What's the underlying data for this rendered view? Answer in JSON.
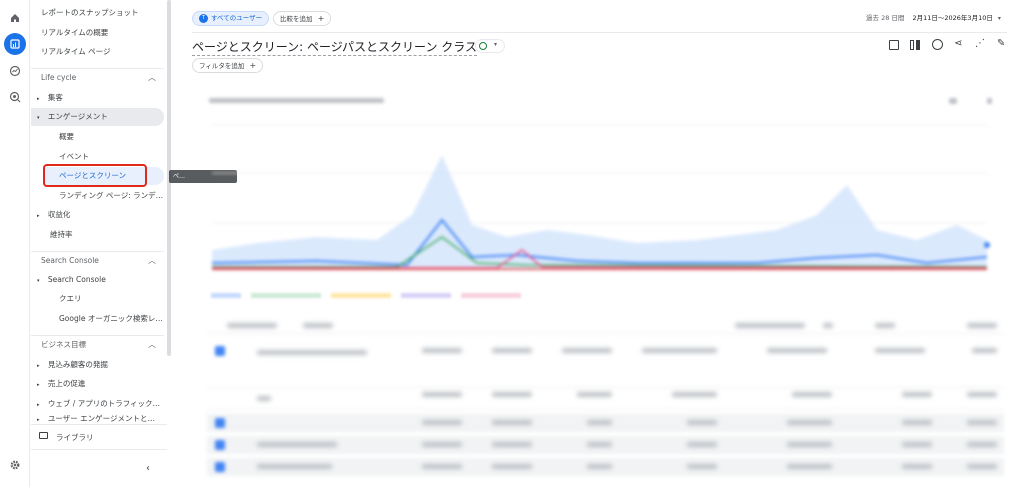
{
  "rail": {
    "icons": [
      "home-icon",
      "reports-icon",
      "explore-icon",
      "advertising-icon",
      "settings-icon"
    ]
  },
  "sidebar": {
    "top_items": [
      "レポートのスナップショット",
      "リアルタイムの概要",
      "リアルタイム ページ"
    ],
    "lifecycle": {
      "heading": "Life cycle",
      "items": [
        {
          "label": "集客"
        },
        {
          "label": "エンゲージメント"
        },
        {
          "label": "概要"
        },
        {
          "label": "イベント"
        },
        {
          "label": "ページとスクリーン"
        },
        {
          "label": "ランディング ページ: ランデ…"
        },
        {
          "label": "収益化"
        },
        {
          "label": "維持率"
        }
      ]
    },
    "search_console": {
      "heading": "Search Console",
      "items": [
        {
          "label": "Search Console"
        },
        {
          "label": "クエリ"
        },
        {
          "label": "Google オーガニック検索レ…"
        }
      ]
    },
    "business": {
      "heading": "ビジネス目標",
      "items": [
        {
          "label": "見込み顧客の発掘"
        },
        {
          "label": "売上の促進"
        },
        {
          "label": "ウェブ / アプリのトラフィック…"
        },
        {
          "label": "ユーザー エンゲージメントと…"
        }
      ]
    },
    "library": "ライブラリ",
    "tooltip": "ペ…"
  },
  "header": {
    "segment_chip": "すべてのユーザー",
    "segment_avatar": "T",
    "compare_chip": "比較を追加",
    "date_prefix": "過去 28 日間",
    "date_range": "2月11日～2026年3月10日",
    "title": "ページとスクリーン: ページパスとスクリーン クラス",
    "filter_chip": "フィルタを追加"
  },
  "colors": {
    "accent": "#1a73e8",
    "highlight_box": "#e0281b",
    "series_blue": "#4285f4",
    "series_green": "#34a853",
    "series_orange": "#fbbc04",
    "series_purple": "#7b68ee",
    "series_pink": "#ea4c89",
    "band": "#d2e3fc"
  }
}
